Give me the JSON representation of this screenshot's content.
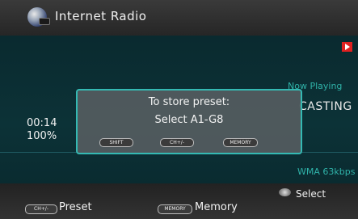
{
  "header": {
    "title": "Internet Radio"
  },
  "now_playing": {
    "label": "Now Playing",
    "station": "CASTING",
    "time": "00:14",
    "volume": "100%",
    "format": "WMA 63kbps"
  },
  "popup": {
    "line1": "To store preset:",
    "line2": "Select A1-G8",
    "keys": [
      "SHIFT",
      "CH+/-",
      "MEMORY"
    ]
  },
  "footer": {
    "select_label": "Select",
    "preset_key": "CH+/-",
    "preset_label": "Preset",
    "memory_key": "MEMORY",
    "memory_label": "Memory"
  },
  "colors": {
    "accent": "#34b9b3",
    "play_flag": "#e02020"
  },
  "icons": [
    "globe-icon",
    "play-icon",
    "select-wheel-icon"
  ]
}
